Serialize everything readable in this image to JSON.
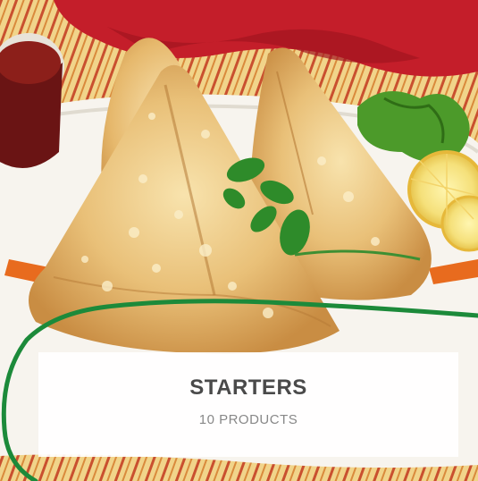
{
  "category_card": {
    "title": "STARTERS",
    "count_label": "10 PRODUCTS"
  },
  "photo": {
    "subject": "samosas on plate",
    "icon_name": "samosa-photo"
  },
  "colors": {
    "highlight_outline": "#1c8a3a",
    "label_background": "#ffffff",
    "title_text": "#4a4a4a",
    "count_text": "#888888"
  }
}
